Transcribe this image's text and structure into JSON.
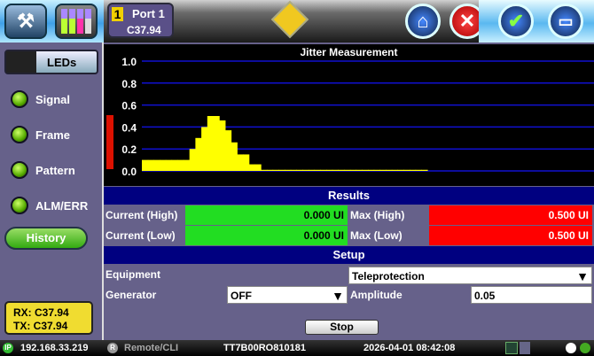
{
  "header": {
    "port_number": "1",
    "port_label": "Port 1",
    "port_mode": "C37.94"
  },
  "icons": {
    "tools": "tools-icon",
    "ports": "port-leds-icon",
    "warning": "signal-warning-icon",
    "home": "home-icon",
    "close": "close-icon",
    "report": "report-icon",
    "files": "folder-icon"
  },
  "left": {
    "leds_button": "LEDs",
    "leds": [
      {
        "label": "Signal"
      },
      {
        "label": "Frame"
      },
      {
        "label": "Pattern"
      },
      {
        "label": "ALM/ERR"
      }
    ],
    "history_button": "History",
    "rx": "RX: C37.94",
    "tx": "TX: C37.94"
  },
  "chart_data": {
    "type": "bar",
    "title": "Jitter Measurement",
    "ylim": [
      0,
      1.0
    ],
    "yticks": [
      "1.0",
      "0.8",
      "0.6",
      "0.4",
      "0.2",
      "0.0"
    ],
    "xlim": [
      0,
      76
    ],
    "values": [
      0.1,
      0.1,
      0.1,
      0.1,
      0.1,
      0.1,
      0.1,
      0.1,
      0.2,
      0.3,
      0.4,
      0.5,
      0.5,
      0.46,
      0.37,
      0.26,
      0.15,
      0.15,
      0.06,
      0.06,
      0.01,
      0.01,
      0.01,
      0.01,
      0.01,
      0.01,
      0.01,
      0.01,
      0.01,
      0.01,
      0.01,
      0.01,
      0.01,
      0.01,
      0.01,
      0.01,
      0.01,
      0.01,
      0.01,
      0.01,
      0.01,
      0.01,
      0.01,
      0.01,
      0.01,
      0.01,
      0.01,
      0.01
    ],
    "current_level": 0.5,
    "bar_color": "#ffff00",
    "grid_color": "#1010d0",
    "level_color": "#dd1100"
  },
  "results": {
    "title": "Results",
    "current_high_label": "Current (High)",
    "current_high": "0.000 UI",
    "current_low_label": "Current (Low)",
    "current_low": "0.000 UI",
    "max_high_label": "Max (High)",
    "max_high": "0.500 UI",
    "max_low_label": "Max (Low)",
    "max_low": "0.500 UI"
  },
  "setup": {
    "title": "Setup",
    "equipment_label": "Equipment",
    "equipment_value": "Teleprotection",
    "generator_label": "Generator",
    "generator_value": "OFF",
    "amplitude_label": "Amplitude",
    "amplitude_value": "0.05",
    "stop_button": "Stop"
  },
  "status": {
    "ip_badge": "IP",
    "ip": "192.168.33.219",
    "remote_badge": "R",
    "remote": "Remote/CLI",
    "serial": "TT7B00RO810181",
    "datetime": "2026-04-01  08:42:08"
  }
}
